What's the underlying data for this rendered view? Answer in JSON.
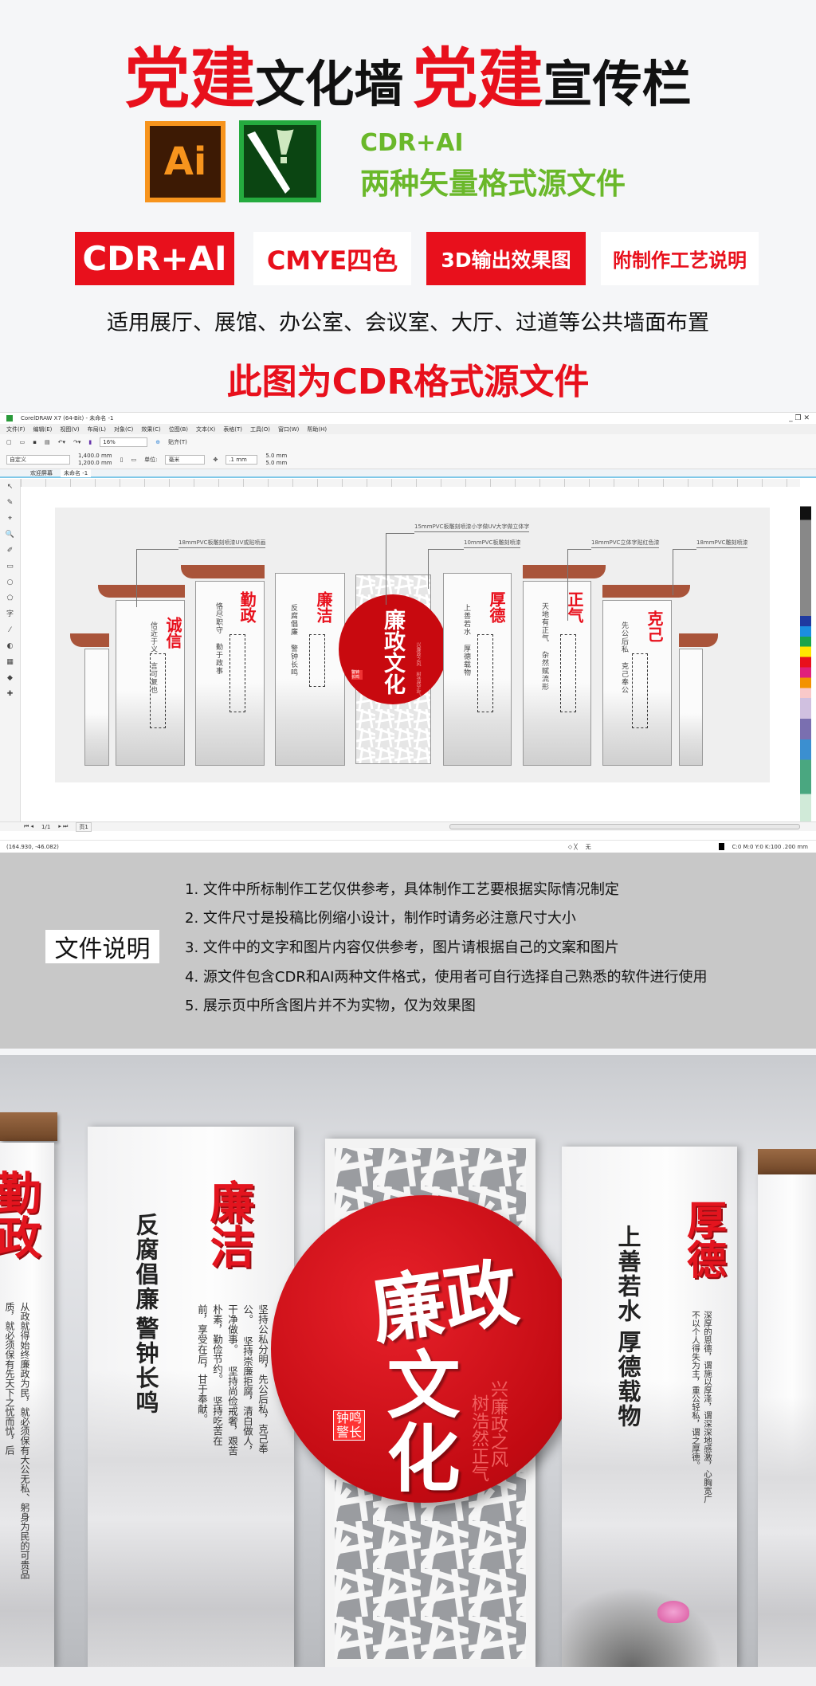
{
  "header": {
    "title": {
      "part1_red": "党建",
      "part1_black": "文化墙",
      "part2_red": "党建",
      "part2_black": "宣传栏"
    },
    "icons": [
      {
        "name": "adobe-illustrator-icon",
        "label": "Ai"
      },
      {
        "name": "coreldraw-icon"
      }
    ],
    "formats_line1": "CDR+AI",
    "formats_line2": "两种矢量格式源文件",
    "badges": [
      {
        "label": "CDR+AI",
        "bg": "#e8101c",
        "fg": "#ffffff"
      },
      {
        "label": "CMYE四色",
        "bg": "#ffffff",
        "fg": "#e8101c"
      },
      {
        "label": "3D输出效果图",
        "bg": "#e8101c",
        "fg": "#ffffff"
      },
      {
        "label": "附制作工艺说明",
        "bg": "#ffffff",
        "fg": "#e8101c"
      }
    ],
    "usage": "适用展厅、展馆、办公室、会议室、大厅、过道等公共墙面布置",
    "notice": "此图为CDR格式源文件"
  },
  "colors": {
    "brand_red": "#e8101c",
    "green": "#6ab82a",
    "cap_brown": "#a9543a",
    "doc_bg": "#c8c8c8"
  },
  "cdr": {
    "window_title": "CorelDRAW X7 (64-Bit) - 未命名 -1",
    "menu": [
      "文件(F)",
      "编辑(E)",
      "视图(V)",
      "布局(L)",
      "对象(C)",
      "效果(C)",
      "位图(B)",
      "文本(X)",
      "表格(T)",
      "工具(O)",
      "窗口(W)",
      "帮助(H)"
    ],
    "zoom": "16%",
    "snap": "贴齐(T)",
    "page_preset": "自定义",
    "width": "1,400.0 mm",
    "height": "1,200.0 mm",
    "units_label": "单位:",
    "units": "毫米",
    "nudge": ".1 mm",
    "dup_x": "5.0 mm",
    "dup_y": "5.0 mm",
    "tabs": [
      "欢迎屏幕",
      "未命名 -1"
    ],
    "page_counter": "1/1",
    "page_tab": "页1",
    "cursor_coords": "(164.930, -46.082)",
    "fill_none": "无",
    "outline_status": "C:0 M:0 Y:0 K:100  .200 mm",
    "annotations": [
      "18mmPVC板雕刻喷漆UV或贴喷画",
      "15mmPVC板雕刻喷漆小字做UV大字做立体字",
      "10mmPVC板雕刻喷漆",
      "18mmPVC立体字贴红色漆",
      "18mmPVC雕刻喷漆"
    ],
    "panels": [
      {
        "title": "诚信",
        "motto": "信近于义 言可复也"
      },
      {
        "title": "勤政",
        "motto": "恪尽职守 勤于政事"
      },
      {
        "title": "廉洁",
        "motto": "反腐倡廉 警钟长鸣"
      },
      {
        "title": "厚德",
        "motto": "上善若水 厚德载物"
      },
      {
        "title": "正气",
        "motto": "天地有正气 杂然赋流形"
      },
      {
        "title": "克己",
        "motto": "先公后私 克己奉公"
      }
    ],
    "center": {
      "title": "廉政文化",
      "seal": "警钟长鸣",
      "slogan": "兴廉政之风 树浩然正气"
    }
  },
  "doc": {
    "label": "文件说明",
    "notes": [
      "1. 文件中所标制作工艺仅供参考，具体制作工艺要根据实际情况制定",
      "2. 文件尺寸是投稿比例缩小设计，制作时请务必注意尺寸大小",
      "3. 文件中的文字和图片内容仅供参考，图片请根据自己的文案和图片",
      "4. 源文件包含CDR和AI两种文件格式，使用者可自行选择自己熟悉的软件进行使用",
      "5. 展示页中所含图片并不为实物，仅为效果图"
    ]
  },
  "render": {
    "left_panel": {
      "title": "勤政",
      "body": [
        "从政就得始终廉政为民，就必须保有大公无私、躬身",
        "为民的可贵品质，就必须保有先天下之忧而忧，后"
      ]
    },
    "panel_lianjie": {
      "title": "廉洁",
      "motto1": "反腐倡廉",
      "motto2": "警钟长鸣",
      "body": [
        "坚持公私分明，先公后私，克己奉公。",
        "坚持崇廉拒腐，清白做人，干净做事。",
        "坚持尚俭戒奢，艰苦朴素，勤俭节约。",
        "坚持吃苦在前，享受在后，甘于奉献。"
      ]
    },
    "center": {
      "title1": "廉政",
      "title2": "文化",
      "seal1": "钟鸣",
      "seal2": "警长",
      "slogan1": "兴廉政之风",
      "slogan2": "树浩然正气"
    },
    "panel_houde": {
      "title": "厚德",
      "motto1": "上善若水",
      "motto2": "厚德载物",
      "body": [
        "深厚的恩德，谓施以厚泽，谓深深地感激，心胸宽广",
        "不以个人得失为主，重公轻私，谓之厚德。"
      ]
    }
  }
}
